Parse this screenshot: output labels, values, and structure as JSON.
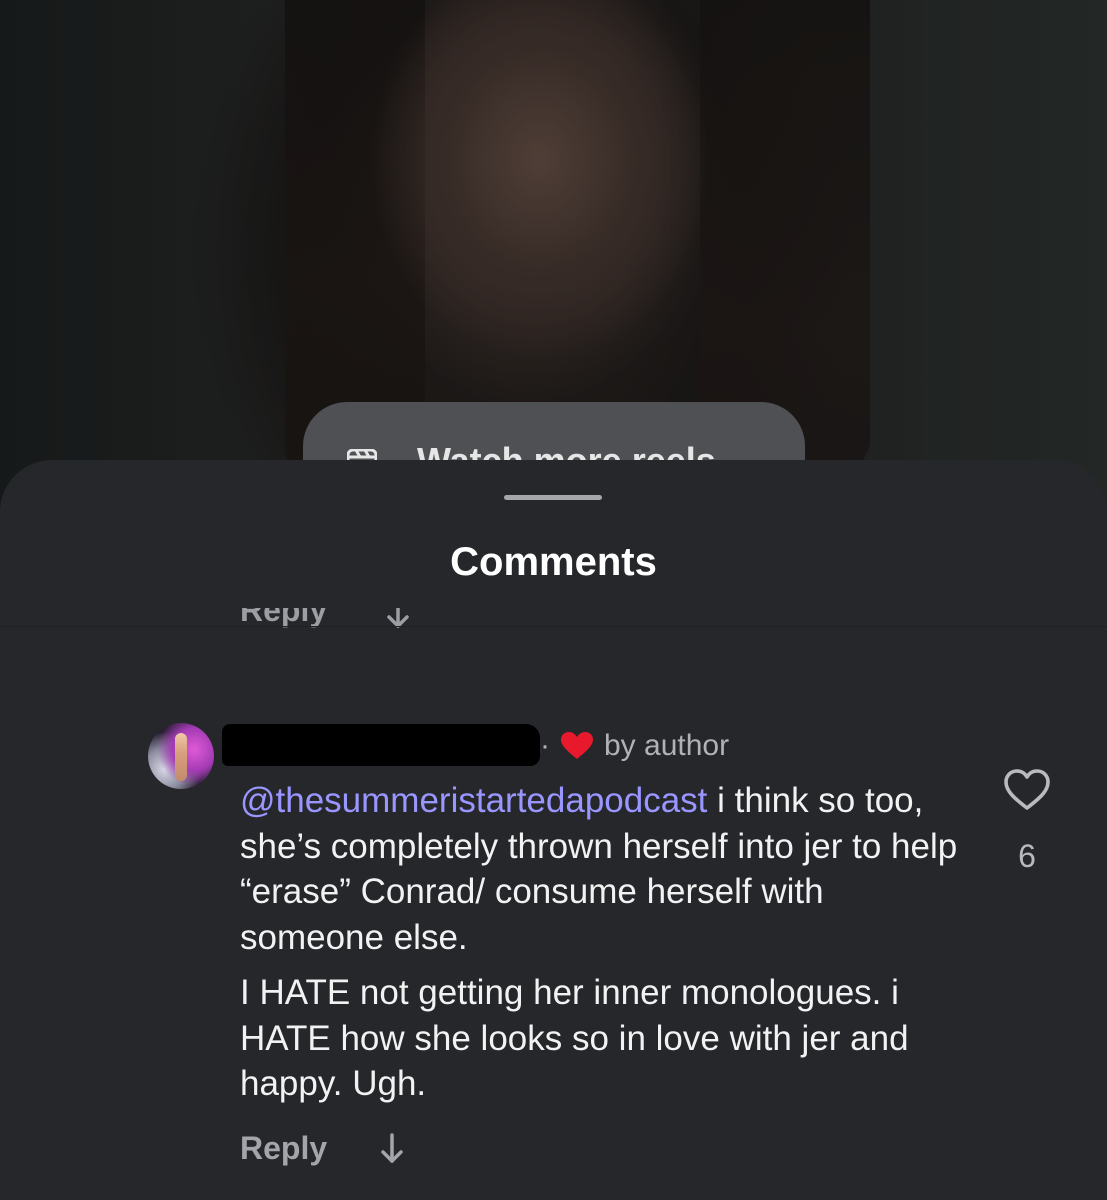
{
  "background": {
    "watch_more_label": "Watch more reels"
  },
  "sheet": {
    "title": "Comments",
    "previous_reply_label": "Reply"
  },
  "comment": {
    "username": "",
    "separator": "·",
    "author_badge_text": "by author",
    "mention": "@thesummeristartedapodcast",
    "paragraph1_rest": " i think so too, she’s completely thrown herself into jer to help “erase” Conrad/ consume herself with someone else.",
    "paragraph2": "I HATE not getting her inner monologues. i HATE how she looks so in love with jer and happy. Ugh.",
    "like_count": "6",
    "reply_label": "Reply",
    "icons": {
      "like": "heart-outline-icon",
      "author_heart": "heart-filled-icon",
      "translate": "arrow-down-icon"
    },
    "colors": {
      "mention": "#9a96ff",
      "author_heart": "#e8192c"
    }
  }
}
